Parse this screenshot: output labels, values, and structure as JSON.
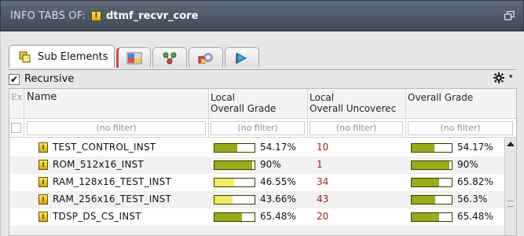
{
  "window": {
    "title_prefix": "INFO TABS OF:",
    "instance_name": "dtmf_recvr_core",
    "instance_icon_letter": "I"
  },
  "tabs": [
    {
      "label": "Sub Elements",
      "icon": "sub-elements-icon",
      "active": true
    },
    {
      "label": "",
      "icon": "hierarchy-grid-icon",
      "active": false
    },
    {
      "label": "",
      "icon": "connections-icon",
      "active": false
    },
    {
      "label": "",
      "icon": "color-palette-icon",
      "active": false
    },
    {
      "label": "",
      "icon": "flag-arrow-icon",
      "active": false
    }
  ],
  "toolbar": {
    "recursive_label": "Recursive",
    "recursive_checked": true,
    "recursive_mark": "✔"
  },
  "table": {
    "headers": {
      "ex": "Ex",
      "name": "Name",
      "local_grade_1": "Local",
      "local_grade_2": "Overall Grade",
      "local_uncovered_1": "Local",
      "local_uncovered_2": "Overall Uncoverec",
      "overall_grade": "Overall Grade"
    },
    "filter_placeholder": "(no filter)",
    "rows": [
      {
        "name": "TEST_CONTROL_INST",
        "local_grade": "54.17%",
        "local_grade_value": 54.17,
        "uncovered": "10",
        "overall_grade": "54.17%",
        "overall_grade_value": 54.17
      },
      {
        "name": "ROM_512x16_INST",
        "local_grade": "90%",
        "local_grade_value": 90,
        "uncovered": "1",
        "overall_grade": "90%",
        "overall_grade_value": 90
      },
      {
        "name": "RAM_128x16_TEST_INST",
        "local_grade": "46.55%",
        "local_grade_value": 46.55,
        "uncovered": "34",
        "overall_grade": "65.82%",
        "overall_grade_value": 65.82
      },
      {
        "name": "RAM_256x16_TEST_INST",
        "local_grade": "43.66%",
        "local_grade_value": 43.66,
        "uncovered": "43",
        "overall_grade": "56.3%",
        "overall_grade_value": 56.3
      },
      {
        "name": "TDSP_DS_CS_INST",
        "local_grade": "65.48%",
        "local_grade_value": 65.48,
        "uncovered": "20",
        "overall_grade": "65.48%",
        "overall_grade_value": 65.48
      },
      {
        "name": "",
        "local_grade": "",
        "local_grade_value": 0,
        "uncovered": "",
        "overall_grade": "",
        "overall_grade_value": 0
      }
    ]
  },
  "colors": {
    "grade_high": "#9aac16",
    "grade_mid": "#f3eb61",
    "uncovered_text": "#a02020",
    "title_bar": "#4f5a69"
  }
}
